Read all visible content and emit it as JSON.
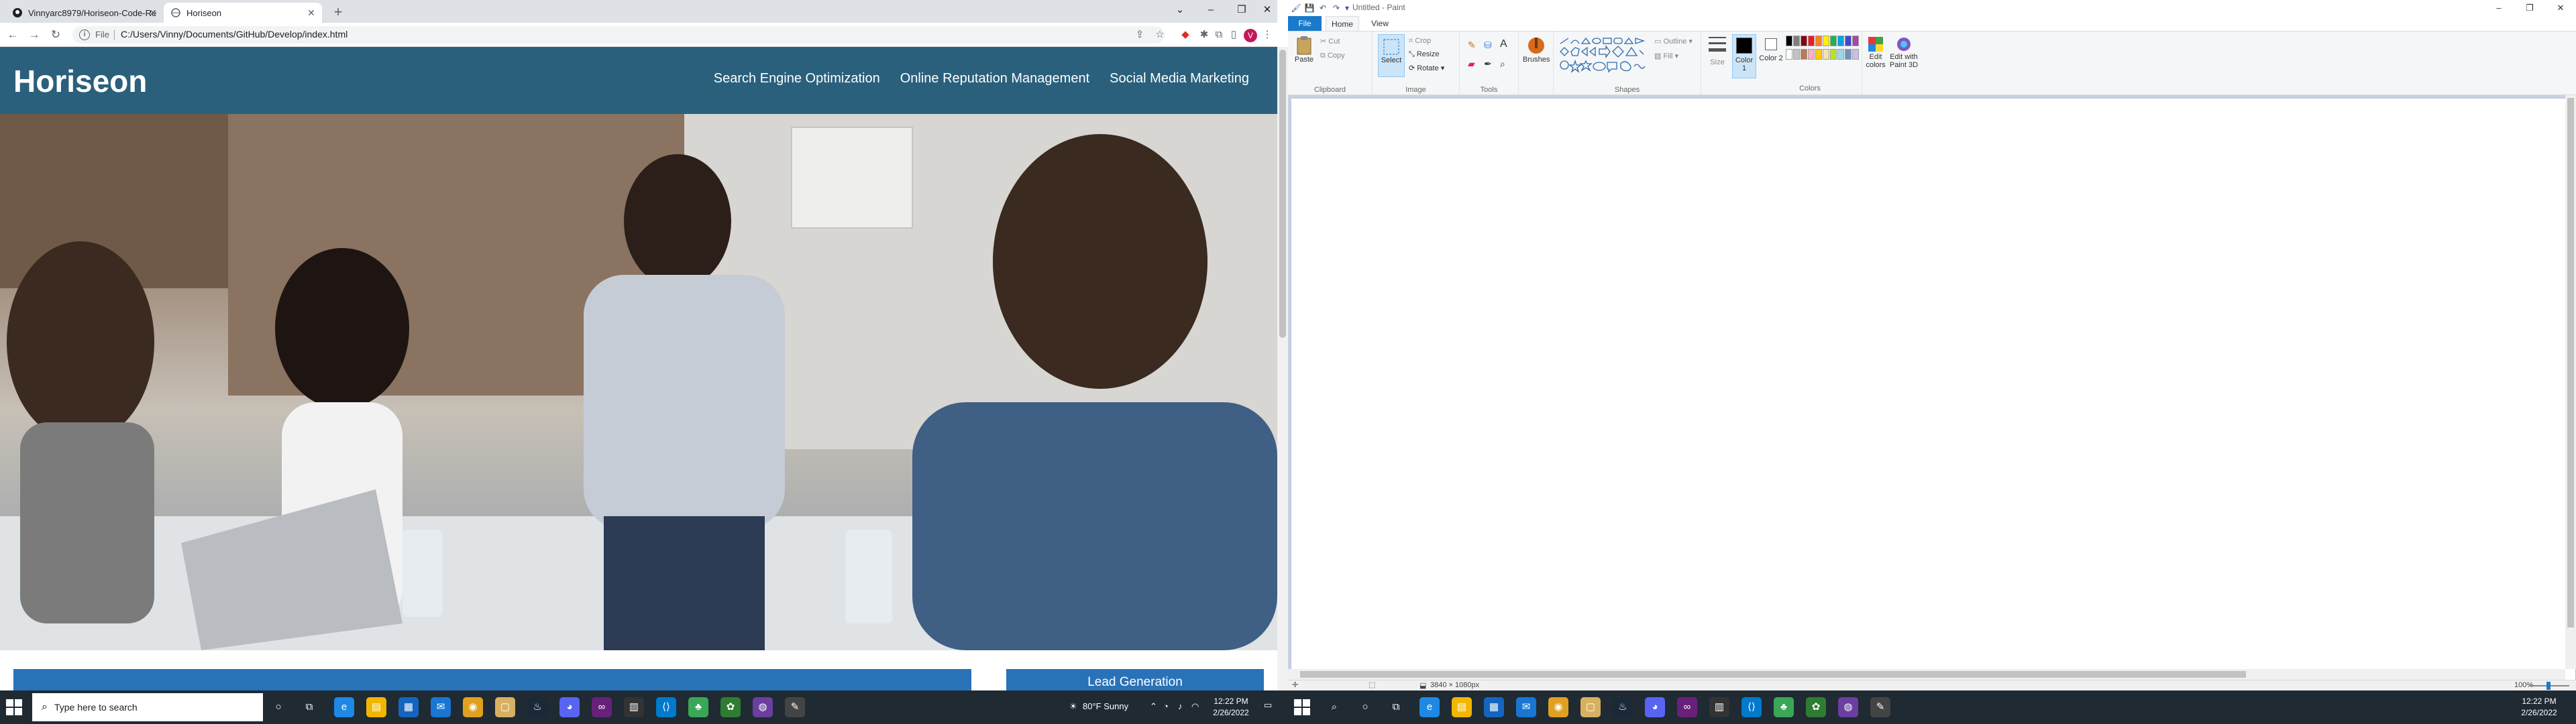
{
  "chrome": {
    "tabs": [
      {
        "label": "Vinnyarc8979/Horiseon-Code-Re"
      },
      {
        "label": "Horiseon"
      }
    ],
    "new_tab": "+",
    "omnibox": {
      "file_label": "File",
      "url": "C:/Users/Vinny/Documents/GitHub/Develop/index.html"
    },
    "profile_initial": "V"
  },
  "site": {
    "logo": "Horiseon",
    "nav": [
      "Search Engine Optimization",
      "Online Reputation Management",
      "Social Media Marketing"
    ],
    "lead_card_title": "Lead Generation"
  },
  "taskbar": {
    "search_placeholder": "Type here to search",
    "weather": "80°F  Sunny",
    "time": "12:22 PM",
    "date": "2/26/2022"
  },
  "paint": {
    "title": "Untitled - Paint",
    "tabs": {
      "file": "File",
      "home": "Home",
      "view": "View"
    },
    "clipboard": {
      "paste": "Paste",
      "cut": "Cut",
      "copy": "Copy",
      "label": "Clipboard"
    },
    "image": {
      "select": "Select",
      "crop": "Crop",
      "resize": "Resize",
      "rotate": "Rotate",
      "label": "Image"
    },
    "tools": {
      "label": "Tools"
    },
    "brushes": "Brushes",
    "shapes": {
      "outline": "Outline",
      "fill": "Fill",
      "label": "Shapes"
    },
    "size": "Size",
    "colors": {
      "color1": "Color 1",
      "color2": "Color 2",
      "edit": "Edit colors",
      "paint3d": "Edit with Paint 3D",
      "label": "Colors"
    },
    "status_dimensions": "3840 × 1080px",
    "zoom": "100%",
    "palette": [
      "#000000",
      "#7f7f7f",
      "#880015",
      "#ed1c24",
      "#ff7f27",
      "#fff200",
      "#22b14c",
      "#00a2e8",
      "#3f48cc",
      "#a349a4",
      "#ffffff",
      "#c3c3c3",
      "#b97a57",
      "#ffaec9",
      "#ffc90e",
      "#efe4b0",
      "#b5e61d",
      "#99d9ea",
      "#7092be",
      "#c8bfe7"
    ],
    "primary_color": "#000000",
    "secondary_color": "#ffffff"
  }
}
